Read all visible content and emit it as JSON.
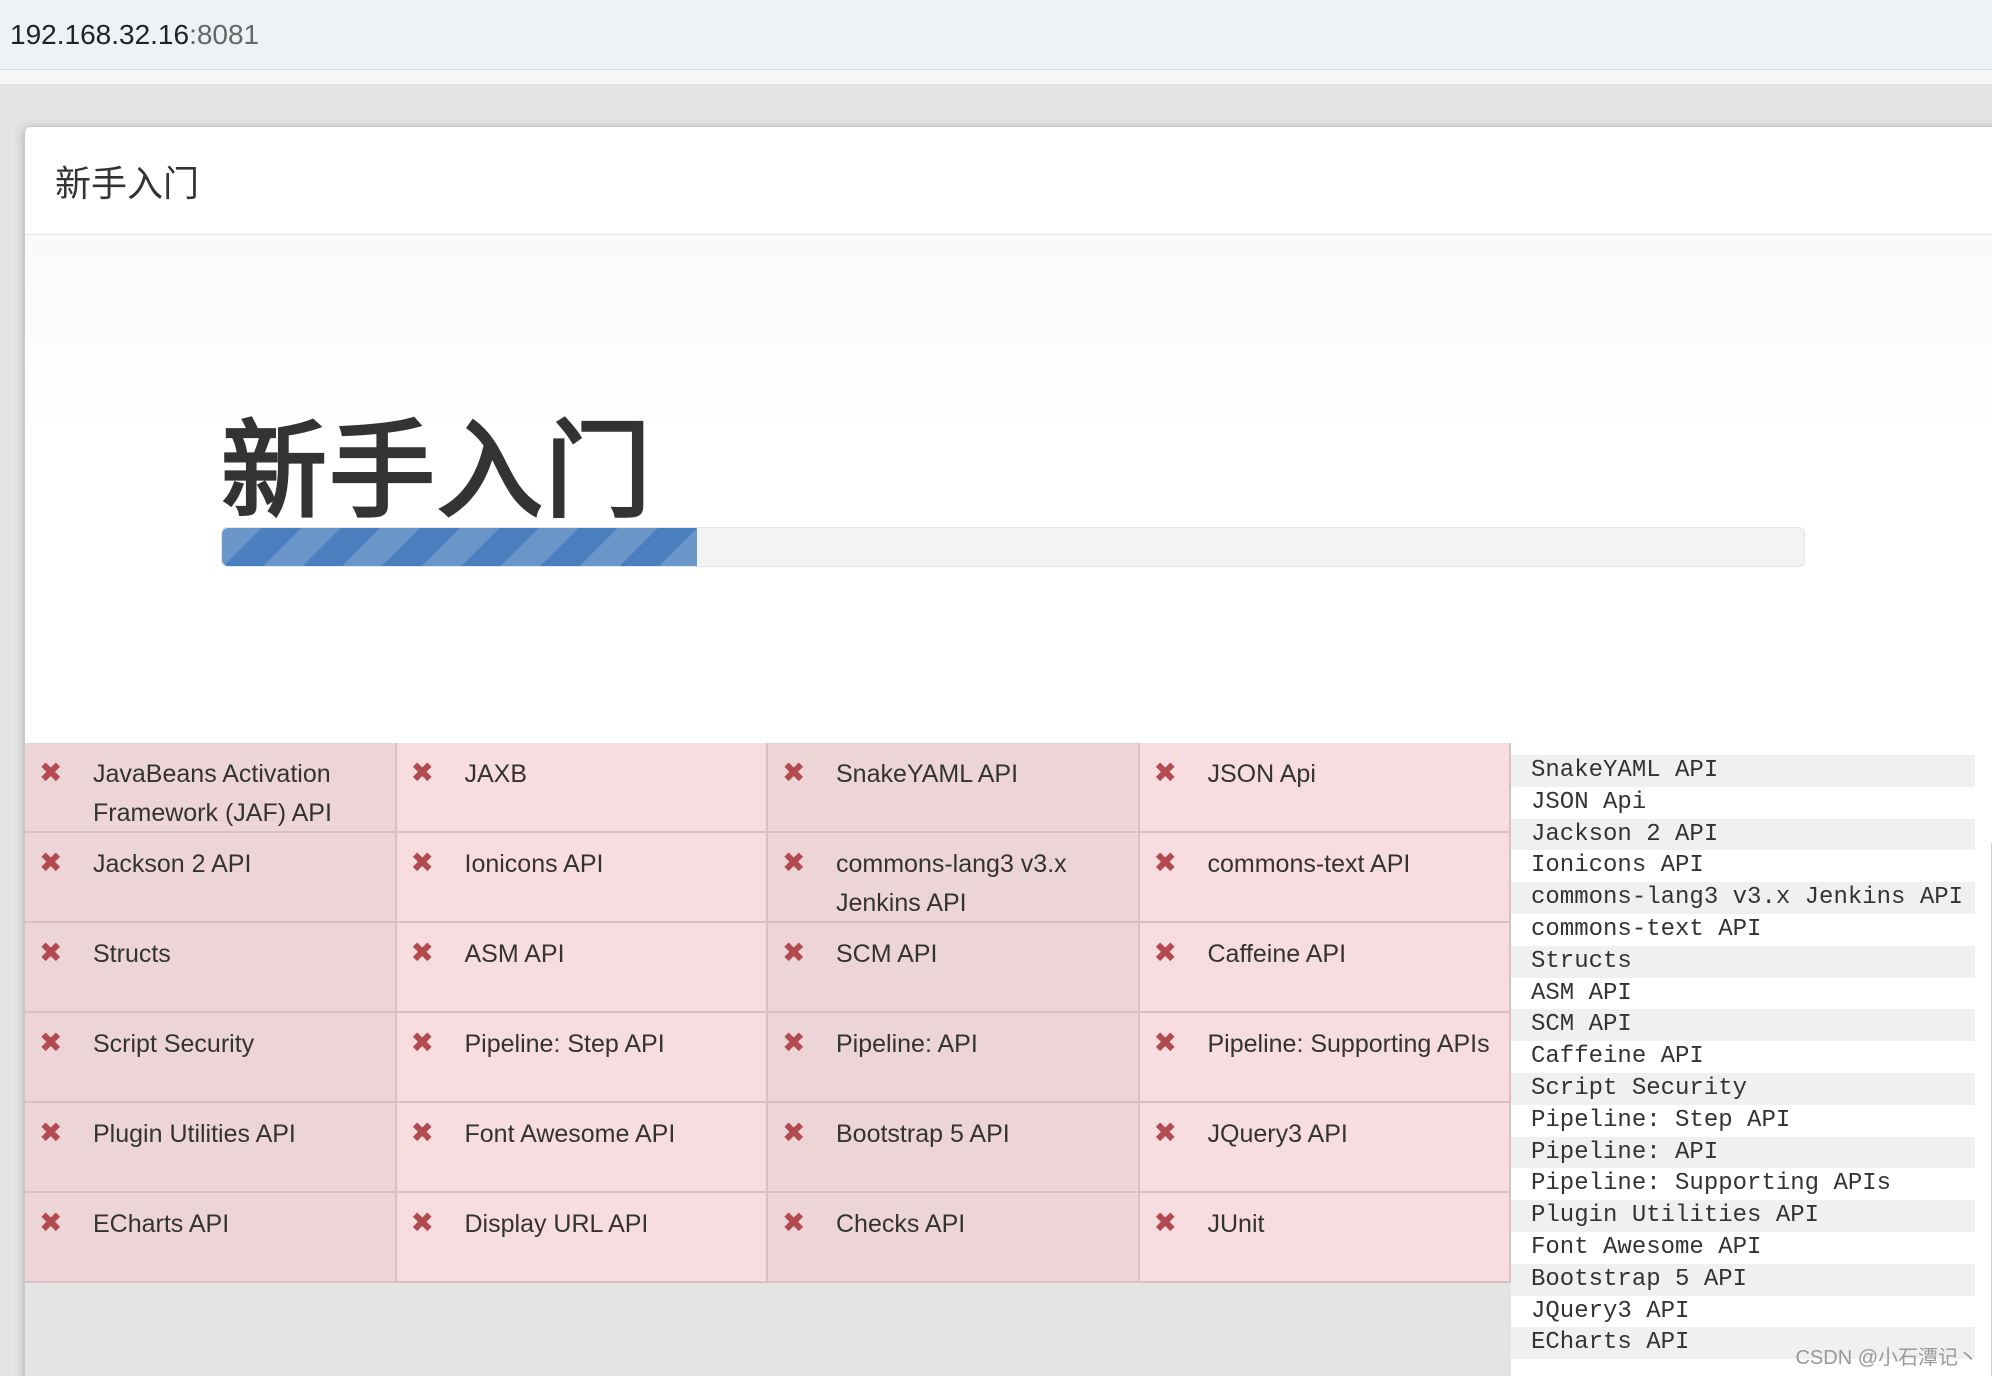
{
  "address": {
    "host": "192.168.32.16",
    "port": ":8081"
  },
  "modal": {
    "header_title": "新手入门",
    "hero_title": "新手入门",
    "progress_percent": 30
  },
  "plugins": [
    "JavaBeans Activation Framework (JAF) API",
    "JAXB",
    "SnakeYAML API",
    "JSON Api",
    "Jackson 2 API",
    "Ionicons API",
    "commons-lang3 v3.x Jenkins API",
    "commons-text API",
    "Structs",
    "ASM API",
    "SCM API",
    "Caffeine API",
    "Script Security",
    "Pipeline: Step API",
    "Pipeline: API",
    "Pipeline: Supporting APIs",
    "Plugin Utilities API",
    "Font Awesome API",
    "Bootstrap 5 API",
    "JQuery3 API",
    "ECharts API",
    "Display URL API",
    "Checks API",
    "JUnit"
  ],
  "failed_icon": "✖",
  "log_lines": [
    "SnakeYAML API",
    "JSON Api",
    "Jackson 2 API",
    "Ionicons API",
    "commons-lang3 v3.x Jenkins API",
    "commons-text API",
    "Structs",
    "ASM API",
    "SCM API",
    "Caffeine API",
    "Script Security",
    "Pipeline: Step API",
    "Pipeline: API",
    "Pipeline: Supporting APIs",
    "Plugin Utilities API",
    "Font Awesome API",
    "Bootstrap 5 API",
    "JQuery3 API",
    "ECharts API"
  ],
  "watermark": "CSDN @小石潭记丶",
  "colors": {
    "progress": "#4a7fbf",
    "failed": "#b34a4f",
    "cell_bg": "#f8dde0"
  }
}
